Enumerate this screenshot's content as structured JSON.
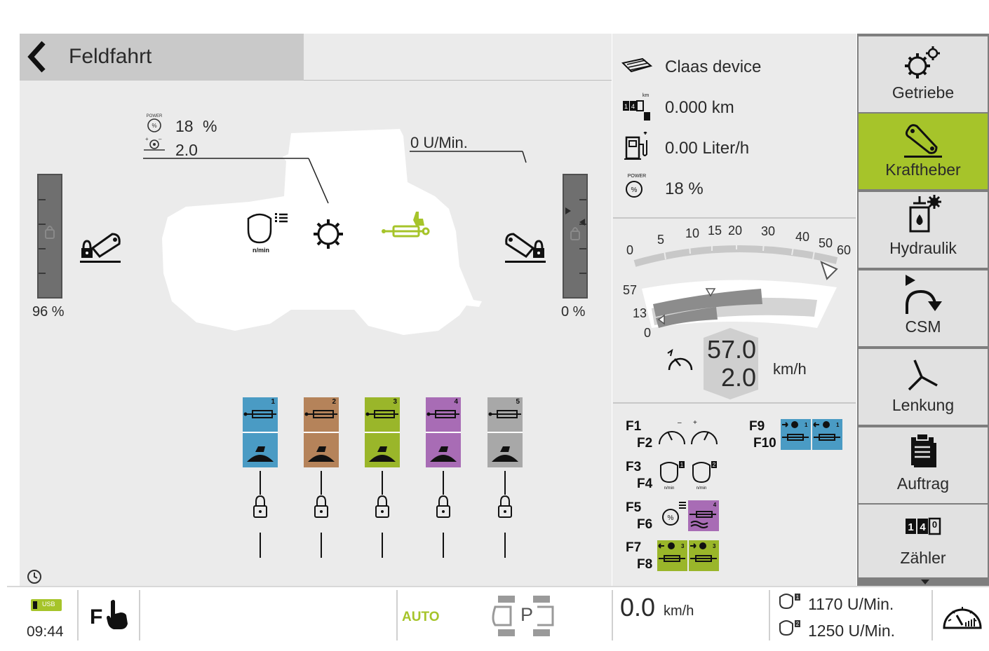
{
  "header": {
    "title": "Feldfahrt"
  },
  "tractor": {
    "power_value": "18",
    "power_unit": "%",
    "slip_value": "2.0",
    "pto_speed": "0 U/Min.",
    "front_link_percent": "96 %",
    "rear_link_percent": "0 %"
  },
  "info": {
    "device": "Claas device",
    "distance": "0.000 km",
    "fuel": "0.00 Liter/h",
    "power": "18 %"
  },
  "speed_gauge": {
    "scale_labels": [
      "0",
      "5",
      "10",
      "15",
      "20",
      "30",
      "40",
      "50",
      "60"
    ],
    "side_labels": [
      "57",
      "13",
      "0"
    ],
    "target_speed": "57.0",
    "actual_speed": "2.0",
    "unit": "km/h"
  },
  "valves": [
    {
      "number": "1",
      "color": "#4a9bc4"
    },
    {
      "number": "2",
      "color": "#b5835a"
    },
    {
      "number": "3",
      "color": "#9ab62a"
    },
    {
      "number": "4",
      "color": "#a86cb5"
    },
    {
      "number": "5",
      "color": "#a8a8a8"
    }
  ],
  "function_keys": {
    "f1": "F1",
    "f2": "F2",
    "f3": "F3",
    "f4": "F4",
    "f5": "F5",
    "f6": "F6",
    "f7": "F7",
    "f8": "F8",
    "f9": "F9",
    "f10": "F10"
  },
  "sidebar": {
    "items": [
      {
        "label": "Getriebe",
        "icon": "gears-icon"
      },
      {
        "label": "Kraftheber",
        "icon": "hitch-icon"
      },
      {
        "label": "Hydraulik",
        "icon": "hydraulic-icon"
      },
      {
        "label": "CSM",
        "icon": "csm-icon"
      },
      {
        "label": "Lenkung",
        "icon": "steering-icon"
      },
      {
        "label": "Auftrag",
        "icon": "clipboard-icon"
      },
      {
        "label": "Zähler",
        "icon": "counter-icon"
      }
    ]
  },
  "status": {
    "usb": "USB",
    "time": "09:44",
    "auto": "AUTO",
    "park": "P",
    "speed_value": "0.0",
    "speed_unit": "km/h",
    "rpm1": "1170 U/Min.",
    "rpm2": "1250 U/Min."
  },
  "colors": {
    "accent_green": "#a6c42a",
    "panel_gray": "#ebebeb",
    "header_gray": "#c9c9c9"
  }
}
